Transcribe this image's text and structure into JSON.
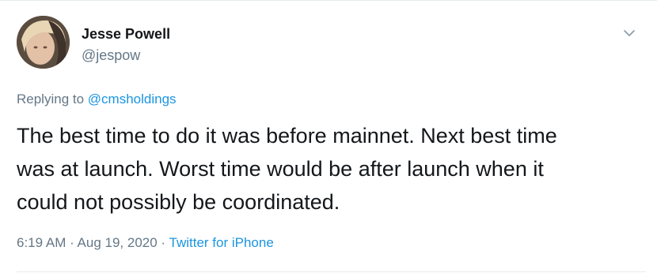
{
  "author": {
    "name": "Jesse Powell",
    "handle": "@jespow"
  },
  "reply": {
    "prefix": "Replying to ",
    "mention": "@cmsholdings"
  },
  "tweet": {
    "text": "The best time to do it was before mainnet. Next best time\nwas at launch. Worst time would be after launch when it\ncould not possibly be coordinated."
  },
  "meta": {
    "time": "6:19 AM",
    "separator1": " · ",
    "date": "Aug 19, 2020",
    "separator2": " · ",
    "source": "Twitter for iPhone"
  },
  "icons": {
    "menu": "chevron-down-icon"
  },
  "colors": {
    "link": "#1b95e0",
    "secondary_text": "#657786",
    "primary_text": "#14171a"
  }
}
